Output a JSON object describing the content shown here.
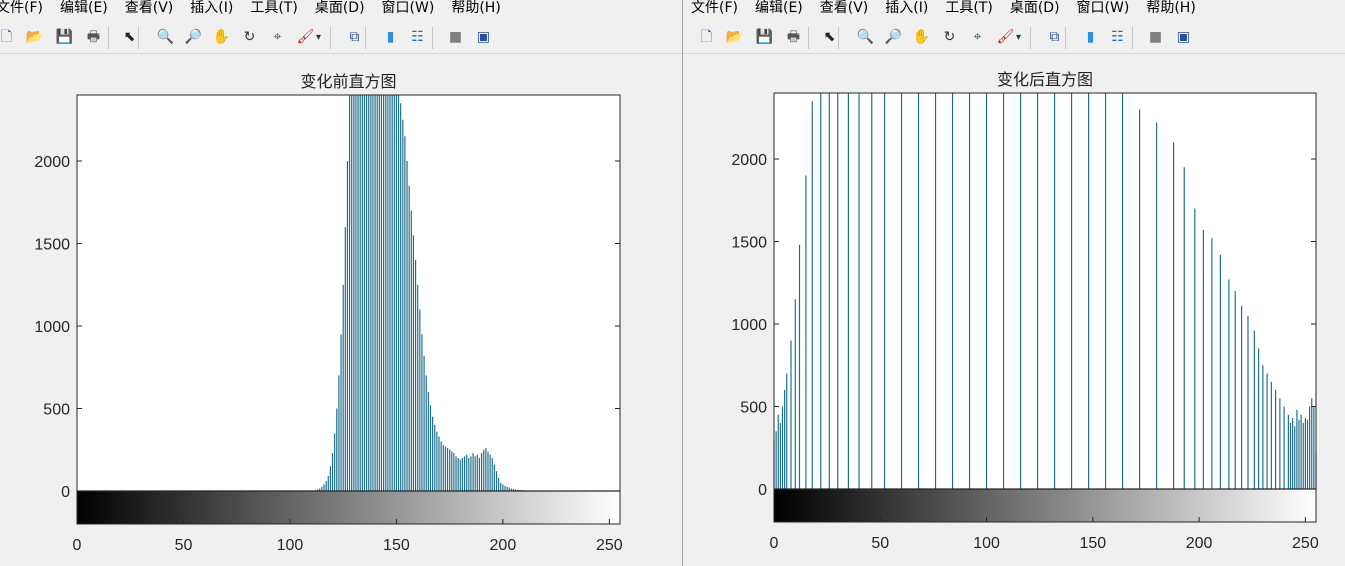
{
  "menus": [
    "文件(F)",
    "编辑(E)",
    "查看(V)",
    "插入(I)",
    "工具(T)",
    "桌面(D)",
    "窗口(W)",
    "帮助(H)"
  ],
  "toolbar_icons": [
    {
      "name": "new-figure-icon",
      "glyph": "🗋",
      "color": "#1e66c8"
    },
    {
      "name": "open-file-icon",
      "glyph": "📂",
      "color": "#d8a020"
    },
    {
      "name": "save-icon",
      "glyph": "💾",
      "color": "#2a4f9a"
    },
    {
      "name": "print-icon",
      "glyph": "🖶",
      "color": "#555555"
    },
    {
      "name": "select-arrow-icon",
      "glyph": "⬉",
      "color": "#222222"
    },
    {
      "name": "zoom-in-icon",
      "glyph": "🔍",
      "color": "#1e66c8"
    },
    {
      "name": "zoom-out-icon",
      "glyph": "🔎",
      "color": "#1e66c8"
    },
    {
      "name": "pan-hand-icon",
      "glyph": "✋",
      "color": "#c08040"
    },
    {
      "name": "rotate-3d-icon",
      "glyph": "↻",
      "color": "#333333"
    },
    {
      "name": "data-cursor-icon",
      "glyph": "⌖",
      "color": "#306030"
    },
    {
      "name": "brush-icon",
      "glyph": "🖌",
      "color": "#c02020"
    },
    {
      "name": "brush-dropdown-icon",
      "glyph": "▾",
      "color": "#333333"
    },
    {
      "name": "link-plot-icon",
      "glyph": "⧉",
      "color": "#2a4f9a"
    },
    {
      "name": "colorbar-icon",
      "glyph": "▮",
      "color": "#3090e0"
    },
    {
      "name": "legend-icon",
      "glyph": "☷",
      "color": "#1e66c8"
    },
    {
      "name": "hide-plot-tools-icon",
      "glyph": "■",
      "color": "#808080"
    },
    {
      "name": "show-plot-tools-icon",
      "glyph": "▣",
      "color": "#2a4f9a"
    }
  ],
  "colors": {
    "bar": "#1c6d8c",
    "axis": "#262626",
    "background": "#f0f0f0"
  },
  "chart_data": [
    {
      "type": "bar",
      "title": "变化前直方图",
      "xlabel": "",
      "ylabel": "",
      "xlim": [
        0,
        255
      ],
      "ylim": [
        -200,
        2400
      ],
      "xticks": [
        0,
        50,
        100,
        150,
        200,
        250
      ],
      "yticks": [
        0,
        500,
        1000,
        1500,
        2000
      ],
      "grid": false,
      "colorbar": "grayscale gradient below axis",
      "values": {
        "x": [
          112,
          113,
          114,
          115,
          116,
          117,
          118,
          119,
          120,
          121,
          122,
          123,
          124,
          125,
          126,
          127,
          128,
          129,
          130,
          131,
          132,
          133,
          134,
          135,
          136,
          137,
          138,
          139,
          140,
          141,
          142,
          143,
          144,
          145,
          146,
          147,
          148,
          149,
          150,
          151,
          152,
          153,
          154,
          155,
          156,
          157,
          158,
          159,
          160,
          161,
          162,
          163,
          164,
          165,
          166,
          167,
          168,
          169,
          170,
          171,
          172,
          173,
          174,
          175,
          176,
          177,
          178,
          179,
          180,
          181,
          182,
          183,
          184,
          185,
          186,
          187,
          188,
          189,
          190,
          191,
          192,
          193,
          194,
          195,
          196,
          197,
          198,
          199,
          200,
          201,
          202,
          203,
          204,
          205,
          206,
          207,
          208,
          209,
          210,
          211,
          212
        ],
        "y": [
          5,
          10,
          15,
          25,
          40,
          60,
          90,
          150,
          230,
          350,
          500,
          700,
          950,
          1250,
          1600,
          2000,
          2400,
          2400,
          2400,
          2400,
          2400,
          2400,
          2400,
          2400,
          2400,
          2400,
          2400,
          2400,
          2400,
          2400,
          2400,
          2400,
          2400,
          2400,
          2400,
          2400,
          2400,
          2400,
          2400,
          2400,
          2350,
          2250,
          2150,
          2000,
          1850,
          1700,
          1550,
          1400,
          1250,
          1100,
          950,
          820,
          700,
          600,
          520,
          450,
          400,
          360,
          330,
          300,
          280,
          270,
          260,
          250,
          240,
          230,
          210,
          200,
          190,
          200,
          210,
          220,
          200,
          210,
          230,
          210,
          220,
          200,
          230,
          250,
          260,
          240,
          220,
          200,
          160,
          120,
          80,
          50,
          40,
          30,
          25,
          20,
          15,
          12,
          10,
          8,
          6,
          5,
          4,
          3,
          2
        ]
      }
    },
    {
      "type": "bar",
      "title": "变化后直方图",
      "xlabel": "",
      "ylabel": "",
      "xlim": [
        0,
        255
      ],
      "ylim": [
        -200,
        2400
      ],
      "xticks": [
        0,
        50,
        100,
        150,
        200,
        250
      ],
      "yticks": [
        0,
        500,
        1000,
        1500,
        2000
      ],
      "grid": false,
      "colorbar": "grayscale gradient below axis",
      "values": {
        "x": [
          0,
          1,
          2,
          3,
          4,
          5,
          6,
          8,
          10,
          12,
          15,
          18,
          22,
          26,
          30,
          35,
          40,
          46,
          52,
          60,
          68,
          76,
          84,
          92,
          100,
          108,
          116,
          124,
          132,
          140,
          148,
          156,
          164,
          172,
          180,
          188,
          193,
          198,
          202,
          206,
          210,
          214,
          217,
          220,
          223,
          226,
          228,
          230,
          232,
          234,
          236,
          238,
          240,
          242,
          243,
          244,
          245,
          246,
          247,
          248,
          249,
          250,
          251,
          252,
          253,
          254,
          255
        ],
        "y": [
          300,
          350,
          450,
          400,
          500,
          600,
          700,
          900,
          1150,
          1480,
          1900,
          2350,
          2400,
          2400,
          2400,
          2400,
          2400,
          2400,
          2400,
          2400,
          2400,
          2400,
          2400,
          2400,
          2400,
          2400,
          2400,
          2400,
          2400,
          2400,
          2400,
          2400,
          2400,
          2300,
          2220,
          2100,
          1950,
          1700,
          1570,
          1520,
          1420,
          1270,
          1200,
          1110,
          1050,
          960,
          850,
          750,
          700,
          650,
          600,
          550,
          500,
          450,
          400,
          430,
          380,
          480,
          420,
          450,
          400,
          430,
          420,
          500,
          550,
          500,
          220
        ]
      }
    }
  ]
}
